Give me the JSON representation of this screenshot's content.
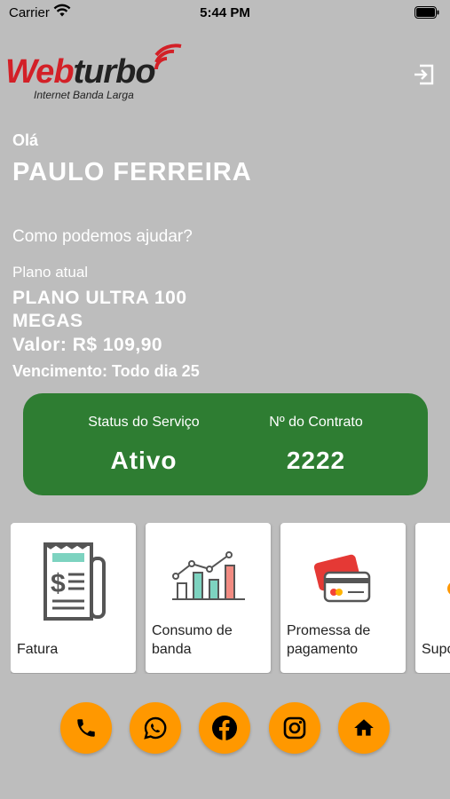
{
  "status_bar": {
    "carrier": "Carrier",
    "time": "5:44 PM"
  },
  "logo": {
    "brand_part1": "Web",
    "brand_part2": "turbo",
    "tagline": "Internet Banda Larga"
  },
  "greeting": {
    "hello": "Olá",
    "name": "PAULO FERREIRA",
    "help": "Como podemos ajudar?"
  },
  "plan": {
    "label": "Plano atual",
    "name": "PLANO ULTRA 100 MEGAS",
    "price": "Valor: R$ 109,90",
    "due": "Vencimento: Todo dia 25"
  },
  "service": {
    "status_label": "Status do Serviço",
    "status_value": "Ativo",
    "contract_label": "Nº do Contrato",
    "contract_value": "2222",
    "color": "#2e7d32"
  },
  "menu": [
    {
      "label": "Fatura",
      "icon": "invoice-icon"
    },
    {
      "label": "Consumo de banda",
      "icon": "bandwidth-chart-icon"
    },
    {
      "label": "Promessa de pagamento",
      "icon": "credit-card-icon"
    },
    {
      "label": "Suporte",
      "icon": "support-icon"
    }
  ],
  "socials": [
    {
      "name": "phone-icon"
    },
    {
      "name": "whatsapp-icon"
    },
    {
      "name": "facebook-icon"
    },
    {
      "name": "instagram-icon"
    },
    {
      "name": "home-icon"
    }
  ],
  "colors": {
    "accent": "#ff9800",
    "brand_red": "#d32027",
    "background": "#bdbdbd"
  }
}
